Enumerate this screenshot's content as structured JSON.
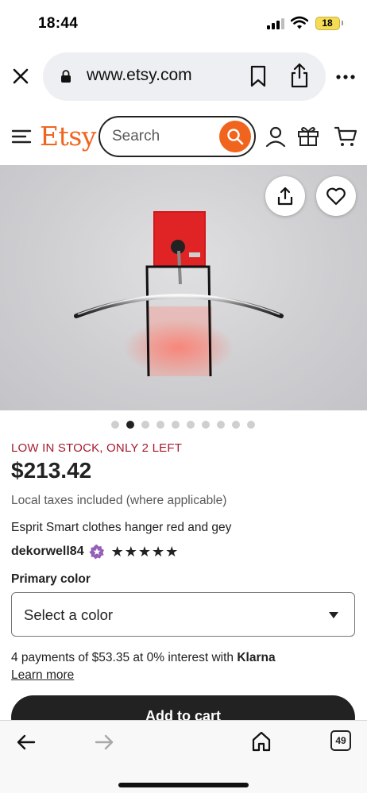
{
  "status_bar": {
    "time": "18:44",
    "battery": "18",
    "icons": [
      "signal-icon",
      "wifi-icon",
      "battery-icon"
    ]
  },
  "browser": {
    "url": "www.etsy.com",
    "icons": [
      "close-icon",
      "lock-icon",
      "bookmark-icon",
      "share-icon",
      "more-icon"
    ]
  },
  "header": {
    "logo": "Etsy",
    "search_placeholder": "Search",
    "icons": [
      "menu-icon",
      "search-icon",
      "user-icon",
      "gift-icon",
      "cart-icon"
    ]
  },
  "gallery": {
    "image_count": 10,
    "active_index": 1,
    "icons": [
      "share-icon",
      "heart-icon"
    ]
  },
  "product": {
    "stock_notice": "LOW IN STOCK, ONLY 2 LEFT",
    "price": "$213.42",
    "taxes_note": "Local taxes included (where applicable)",
    "title": "Esprit Smart clothes hanger red and gey",
    "shop_name": "dekorwell84",
    "rating_stars": "★★★★★",
    "rating": 5
  },
  "variation": {
    "label": "Primary color",
    "placeholder": "Select a color"
  },
  "payment": {
    "installments_text": "4 payments of $53.35 at 0% interest with ",
    "provider": "Klarna",
    "learn_more": "Learn more"
  },
  "cta": {
    "add_to_cart": "Add to cart"
  },
  "toolbar": {
    "tab_count": "49",
    "icons": [
      "back-icon",
      "forward-icon",
      "home-icon",
      "tabs-icon"
    ]
  },
  "colors": {
    "brand": "#f1641e",
    "stock_alert": "#a61a2e",
    "button": "#222222"
  }
}
